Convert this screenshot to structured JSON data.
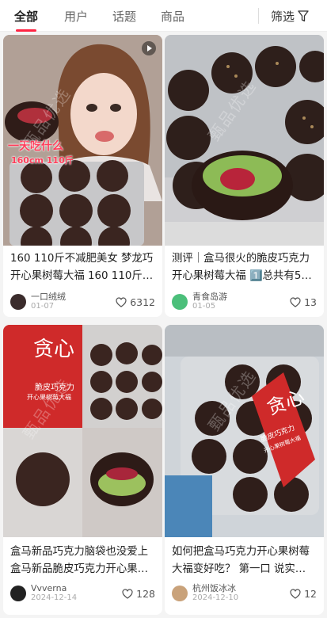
{
  "tabs": [
    {
      "label": "全部",
      "active": true
    },
    {
      "label": "用户",
      "active": false
    },
    {
      "label": "话题",
      "active": false
    },
    {
      "label": "商品",
      "active": false
    }
  ],
  "filter": {
    "label": "筛选",
    "icon": "filter-icon"
  },
  "accent": "#ff2442",
  "watermark": "甄品优选",
  "cards": [
    {
      "title": "160 110斤不减肥美女 梦龙巧开心果树莓大福 160 110斤…",
      "author": "一口绒绒",
      "date": "01-07",
      "likes": "6312",
      "overlay": {
        "line1": "一天吃什么",
        "line2": "160cm 110斤"
      }
    },
    {
      "title": "测评｜盒马很火的脆皮巧克力开心果树莓大福 1️⃣总共有5…",
      "author": "青食岛游",
      "date": "01-05",
      "likes": "13"
    },
    {
      "title": "盒马新品巧克力脑袋也没爱上盒马新品脆皮巧克力开心果…",
      "author": "Vvverna",
      "date": "2024-12-14",
      "likes": "128",
      "package": {
        "brand": "贪心",
        "sub": "脆皮巧克力",
        "sub2": "开心果树莓大福"
      }
    },
    {
      "title": "如何把盒马巧克力开心果树莓大福变好吃？ 第一口 说实…",
      "author": "杭州饭冰冰",
      "date": "2024-12-10",
      "likes": "12",
      "package": {
        "brand": "贪心",
        "sub": "脆皮巧克力",
        "sub2": "开心果树莓大福"
      }
    }
  ]
}
